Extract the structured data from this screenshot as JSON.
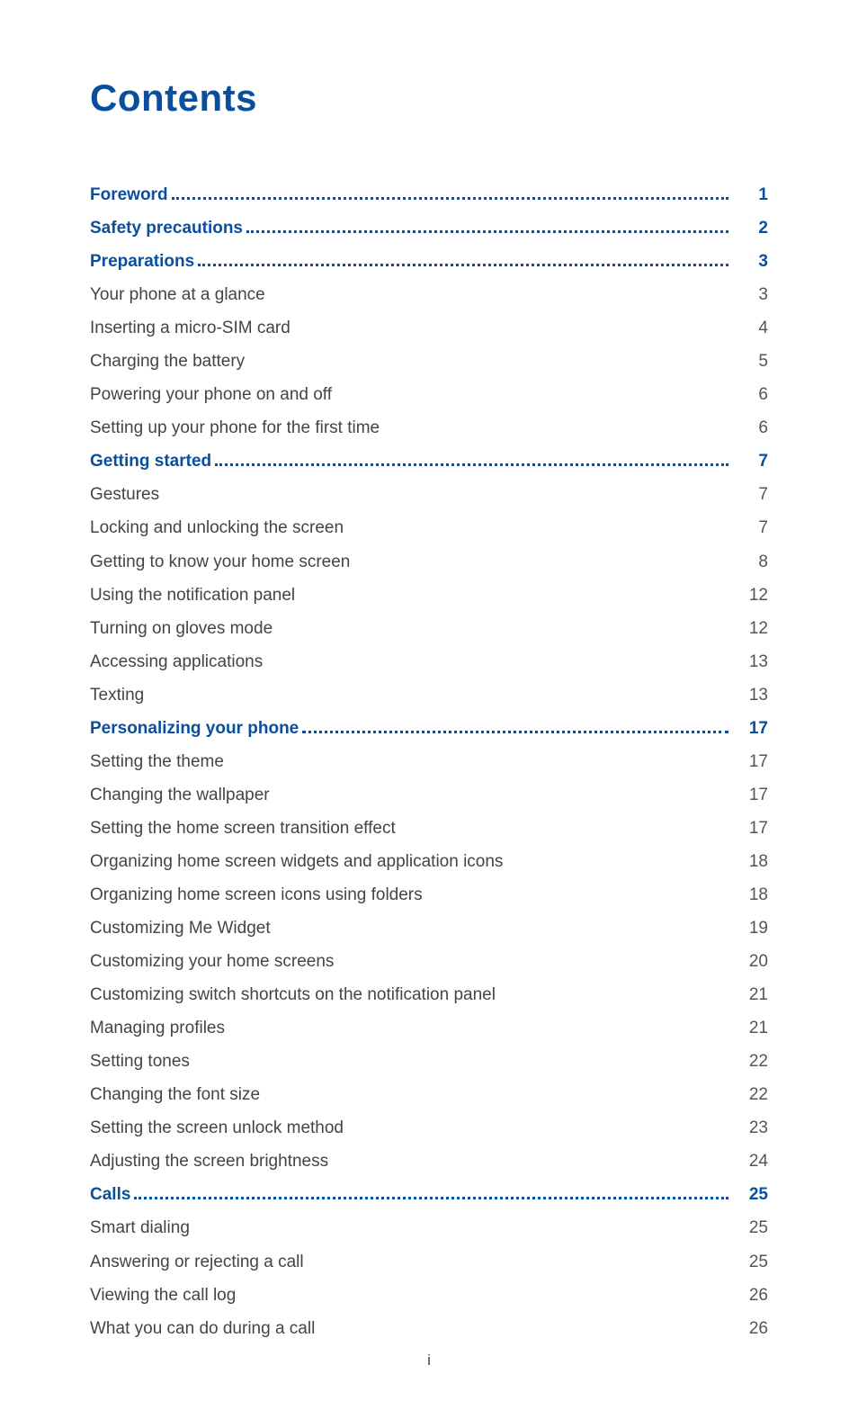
{
  "title": "Contents",
  "footer": "i",
  "toc": [
    {
      "type": "section",
      "label": "Foreword",
      "page": "1"
    },
    {
      "type": "section",
      "label": "Safety precautions",
      "page": "2"
    },
    {
      "type": "section",
      "label": "Preparations",
      "page": "3"
    },
    {
      "type": "sub",
      "label": "Your phone at a glance",
      "page": "3"
    },
    {
      "type": "sub",
      "label": "Inserting a micro-SIM card",
      "page": "4"
    },
    {
      "type": "sub",
      "label": "Charging the battery",
      "page": "5"
    },
    {
      "type": "sub",
      "label": "Powering your phone on and off",
      "page": "6"
    },
    {
      "type": "sub",
      "label": "Setting up your phone for the first time",
      "page": "6"
    },
    {
      "type": "section",
      "label": "Getting started",
      "page": "7"
    },
    {
      "type": "sub",
      "label": "Gestures",
      "page": "7"
    },
    {
      "type": "sub",
      "label": "Locking and unlocking the screen",
      "page": "7"
    },
    {
      "type": "sub",
      "label": "Getting to know your home screen",
      "page": "8"
    },
    {
      "type": "sub",
      "label": "Using the notification panel",
      "page": "12"
    },
    {
      "type": "sub",
      "label": "Turning on gloves mode",
      "page": "12"
    },
    {
      "type": "sub",
      "label": "Accessing applications",
      "page": "13"
    },
    {
      "type": "sub",
      "label": "Texting",
      "page": "13"
    },
    {
      "type": "section",
      "label": "Personalizing your phone",
      "page": "17"
    },
    {
      "type": "sub",
      "label": "Setting the theme",
      "page": "17"
    },
    {
      "type": "sub",
      "label": "Changing the wallpaper",
      "page": "17"
    },
    {
      "type": "sub",
      "label": "Setting the home screen transition effect",
      "page": "17"
    },
    {
      "type": "sub",
      "label": "Organizing home screen widgets and application icons",
      "page": "18"
    },
    {
      "type": "sub",
      "label": "Organizing home screen icons using folders",
      "page": "18"
    },
    {
      "type": "sub",
      "label": "Customizing Me Widget",
      "page": "19"
    },
    {
      "type": "sub",
      "label": "Customizing your home screens",
      "page": "20"
    },
    {
      "type": "sub",
      "label": "Customizing switch shortcuts on the notification panel",
      "page": "21"
    },
    {
      "type": "sub",
      "label": "Managing profiles",
      "page": "21"
    },
    {
      "type": "sub",
      "label": "Setting tones",
      "page": "22"
    },
    {
      "type": "sub",
      "label": "Changing the font size",
      "page": "22"
    },
    {
      "type": "sub",
      "label": "Setting the screen unlock method",
      "page": "23"
    },
    {
      "type": "sub",
      "label": "Adjusting the screen brightness",
      "page": "24"
    },
    {
      "type": "section",
      "label": "Calls",
      "page": "25"
    },
    {
      "type": "sub",
      "label": "Smart dialing",
      "page": "25"
    },
    {
      "type": "sub",
      "label": "Answering or rejecting a call",
      "page": "25"
    },
    {
      "type": "sub",
      "label": "Viewing the call log",
      "page": "26"
    },
    {
      "type": "sub",
      "label": "What you can do during a call",
      "page": "26"
    }
  ]
}
